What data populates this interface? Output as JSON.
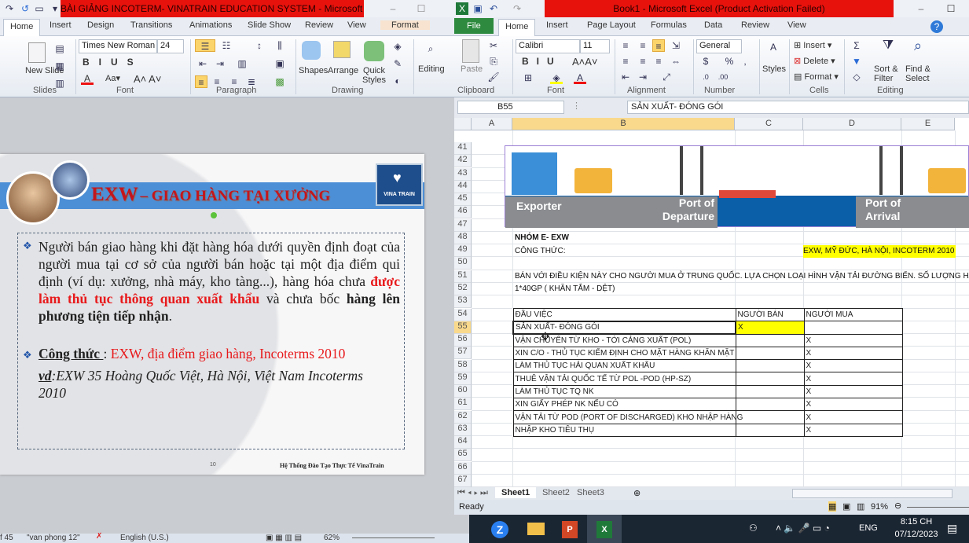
{
  "powerpoint": {
    "title": "BÀI GIẢNG INCOTERM- VINATRAIN EDUCATION SYSTEM  -  Microsoft Powe...",
    "tabs": [
      "Home",
      "Insert",
      "Design",
      "Transitions",
      "Animations",
      "Slide Show",
      "Review",
      "View",
      "Format"
    ],
    "ribbon": {
      "new_slide": "New Slide",
      "font_name": "Times New Roman",
      "font_size": "24",
      "shapes": "Shapes",
      "arrange": "Arrange",
      "quick_styles": "Quick Styles",
      "editing": "Editing",
      "groups": [
        "Slides",
        "Font",
        "Paragraph",
        "Drawing"
      ]
    },
    "slide": {
      "title_main": "EXW",
      "title_sub": "– GIAO HÀNG TẠI XƯỞNG",
      "logo_text": "VINA TRAIN",
      "bullet1_a": "Người bán giao hàng khi đặt hàng hóa dưới quyền định đoạt của người mua tại cơ sở của người bán hoặc tại một địa điểm qui định (ví dụ: xưởng, nhà máy, kho tàng...), hàng hóa chưa ",
      "bullet1_red": "được làm thủ tục thông quan xuất khẩu",
      "bullet1_b": " và chưa bốc ",
      "bullet1_bold": "hàng lên phương tiện tiếp nhận",
      "bullet1_end": ".",
      "formula_label": "Công thức ",
      "formula_colon": ": ",
      "formula_value": "EXW, địa điểm giao hàng, Incoterms 2010",
      "example_label": "vd",
      "example_text": ":EXW 35 Hoàng Quốc Việt, Hà Nội, Việt Nam Incoterms 2010",
      "page_number": "10",
      "footer": "Hệ Thống Đào Tạo Thực Tế VinaTrain"
    },
    "status": {
      "slide": "f 45",
      "theme": "\"van phong 12\"",
      "language": "English (U.S.)",
      "zoom": "62%"
    }
  },
  "excel": {
    "title": "Book1  -  Microsoft Excel (Product Activation Failed)",
    "tabs": [
      "File",
      "Home",
      "Insert",
      "Page Layout",
      "Formulas",
      "Data",
      "Review",
      "View"
    ],
    "ribbon": {
      "paste": "Paste",
      "font_name": "Calibri",
      "font_size": "11",
      "number_format": "General",
      "styles": "Styles",
      "insert": "Insert",
      "delete": "Delete",
      "format": "Format",
      "sort_filter": "Sort & Filter",
      "find_select": "Find & Select",
      "groups": [
        "Clipboard",
        "Font",
        "Alignment",
        "Number",
        "Cells",
        "Editing"
      ]
    },
    "name_box": "B55",
    "formula_value": "SẢN XUẤT- ĐÓNG GÓI",
    "columns": [
      "A",
      "B",
      "C",
      "D",
      "E"
    ],
    "rows": [
      "41",
      "42",
      "43",
      "44",
      "45",
      "46",
      "47",
      "48",
      "49",
      "50",
      "51",
      "52",
      "53",
      "54",
      "55",
      "56",
      "57",
      "58",
      "59",
      "60",
      "61",
      "62",
      "63",
      "64",
      "65",
      "66",
      "67"
    ],
    "active_row": "55",
    "image_labels": {
      "exporter": "Exporter",
      "port_departure": "Port of Departure",
      "port_arrival": "Port of Arrival"
    },
    "cells": {
      "b48": "NHÓM E- EXW",
      "b49": "CÔNG THỨC:",
      "d49": "EXW, MỸ ĐỨC, HÀ NỘI, INCOTERM 2010",
      "b51": "BÁN VỚI ĐIỀU KIỆN NÀY CHO NGƯỜI MUA Ở TRUNG QUỐC. LỰA CHỌN LOẠI HÌNH VẬN TẢI ĐƯỜNG BIỂN. SỐ LƯỢNG HÀNG",
      "b52": "1*40GP ( KHĂN TẮM - DỆT)"
    },
    "table": {
      "headers": [
        "ĐẦU VIỆC",
        "NGƯỜI BÁN",
        "NGƯỜI MUA"
      ],
      "rows": [
        [
          "SẢN XUẤT- ĐÓNG GÓI",
          "X",
          ""
        ],
        [
          "VẬN CHUYỂN TỪ KHO - TỚI CẢNG XUẤT (POL)",
          "",
          "X"
        ],
        [
          "XIN C/O - THỦ TỤC KIỂM ĐỊNH CHO MẶT HÀNG KHĂN MẶT",
          "",
          "X"
        ],
        [
          "LÀM THỦ TỤC HẢI QUAN XUẤT KHẨU",
          "",
          "X"
        ],
        [
          "THUÊ VẬN TẢI QUỐC TẾ TỪ POL -POD (HP-SZ)",
          "",
          "X"
        ],
        [
          "LÀM THỦ TỤC TQ NK",
          "",
          "X"
        ],
        [
          "XIN GIẤY PHÉP NK NẾU CÓ",
          "",
          "X"
        ],
        [
          "VẬN TẢI TỪ POD (PORT OF DISCHARGED)  KHO NHẬP HÀNG",
          "",
          "X"
        ],
        [
          "NHẬP KHO TIÊU THỤ",
          "",
          "X"
        ]
      ]
    },
    "sheets": [
      "Sheet1",
      "Sheet2",
      "Sheet3"
    ],
    "status": "Ready",
    "zoom": "91%",
    "highlight_color": "#ffff00"
  },
  "taskbar": {
    "lang": "ENG",
    "time": "8:15 CH",
    "date": "07/12/2023"
  }
}
